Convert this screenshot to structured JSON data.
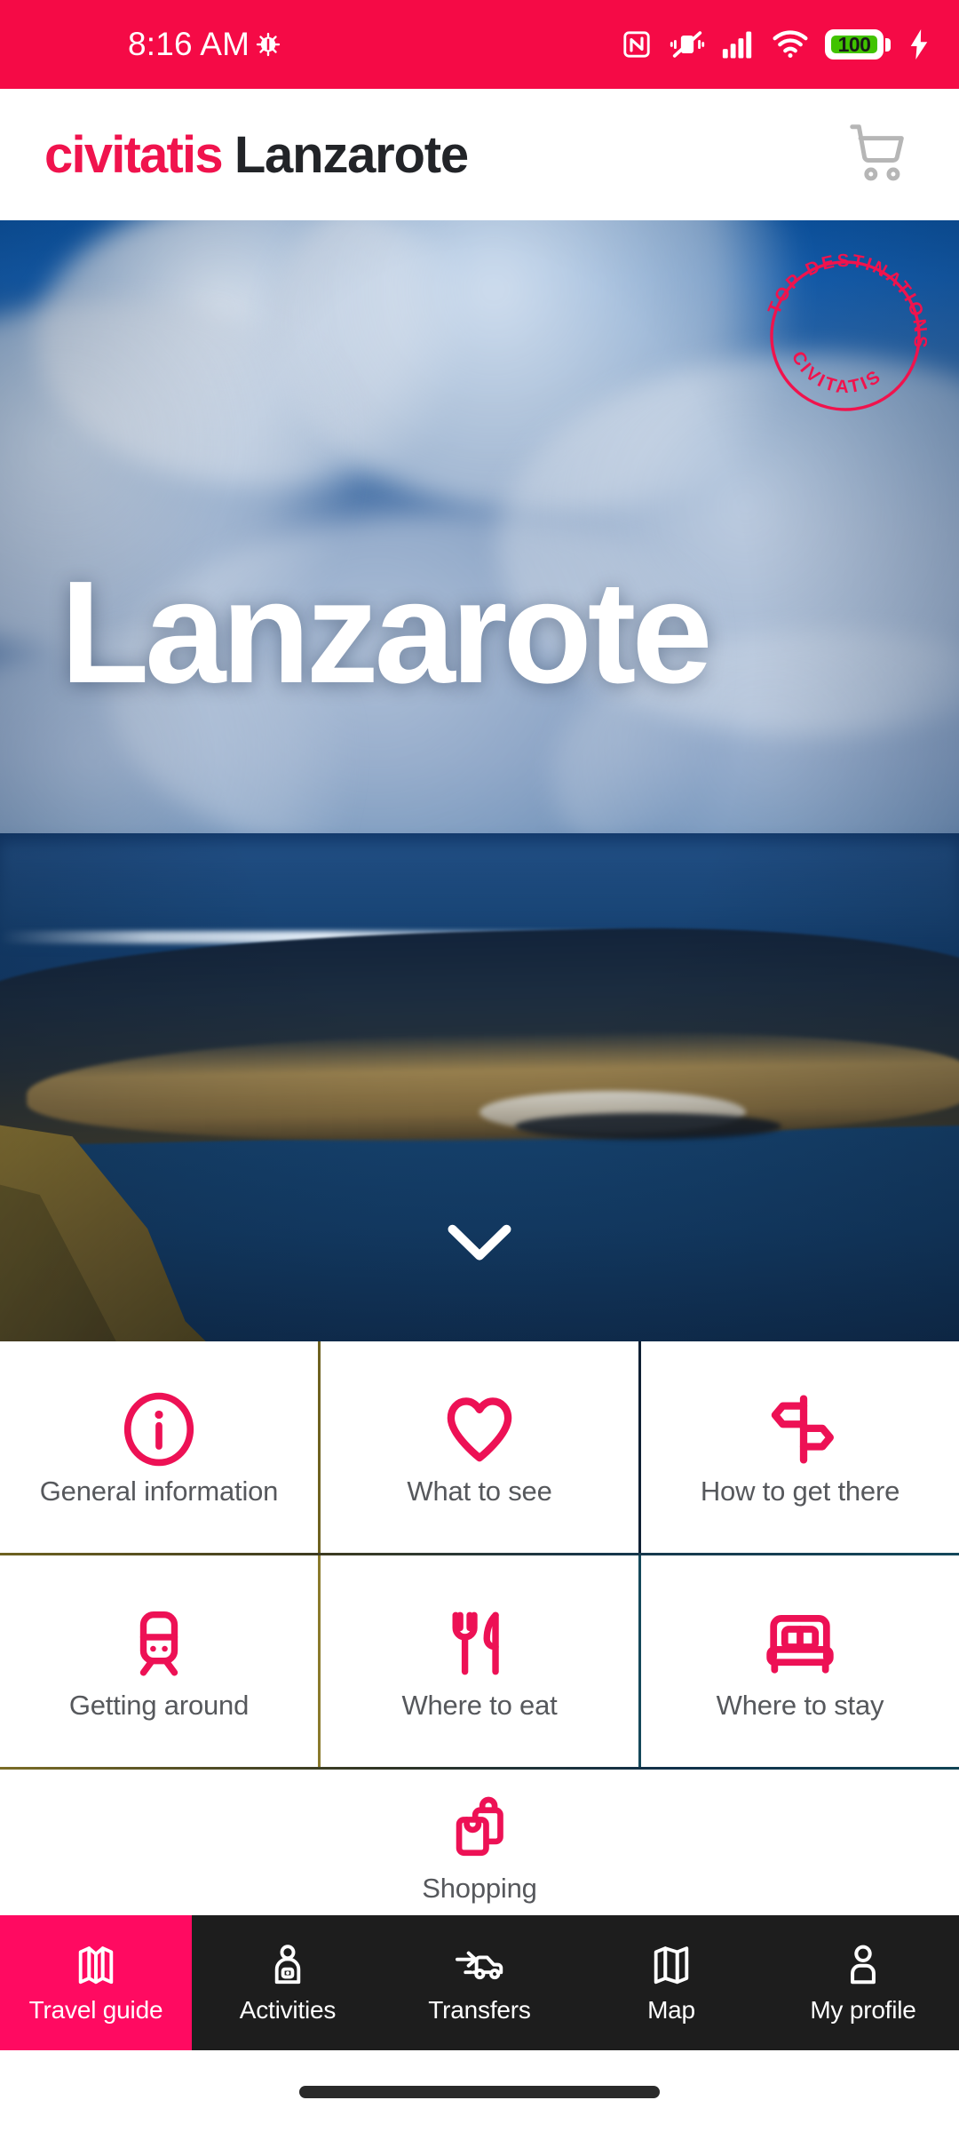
{
  "status_bar": {
    "time": "8:16 AM",
    "battery_percent": "100",
    "icons": [
      "bug-icon",
      "nfc-icon",
      "vibrate-off-icon",
      "signal-bars-icon",
      "wifi-icon",
      "battery-icon",
      "charging-bolt-icon"
    ],
    "bg_color": "#F50A46"
  },
  "app_bar": {
    "brand": "civitatis",
    "destination": "Lanzarote",
    "brand_color": "#F0134D",
    "destination_color": "#222428",
    "cart_icon": "shopping-cart-icon"
  },
  "hero": {
    "title": "Lanzarote",
    "badge_top": "TOP DESTINATIONS",
    "badge_bottom": "CIVITATIS",
    "badge_color": "#F0134D",
    "scroll_hint_icon": "chevron-down-icon"
  },
  "menu": {
    "rows": [
      [
        {
          "label": "General information",
          "icon": "info-circle-icon"
        },
        {
          "label": "What to see",
          "icon": "heart-icon"
        },
        {
          "label": "How to get there",
          "icon": "signpost-icon"
        }
      ],
      [
        {
          "label": "Getting around",
          "icon": "train-icon"
        },
        {
          "label": "Where to eat",
          "icon": "cutlery-icon"
        },
        {
          "label": "Where to stay",
          "icon": "bed-icon"
        }
      ],
      [
        {
          "label": "Shopping",
          "icon": "shopping-bags-icon"
        }
      ]
    ],
    "icon_color": "#ED1155",
    "label_color": "#56585c"
  },
  "bottom_nav": {
    "active_color": "#FF0A61",
    "bg_color": "#1d1d1d",
    "items": [
      {
        "label": "Travel guide",
        "icon": "folded-map-icon",
        "active": true
      },
      {
        "label": "Activities",
        "icon": "person-activity-icon",
        "active": false
      },
      {
        "label": "Transfers",
        "icon": "transfer-car-icon",
        "active": false
      },
      {
        "label": "Map",
        "icon": "map-icon",
        "active": false
      },
      {
        "label": "My profile",
        "icon": "person-icon",
        "active": false
      }
    ]
  }
}
